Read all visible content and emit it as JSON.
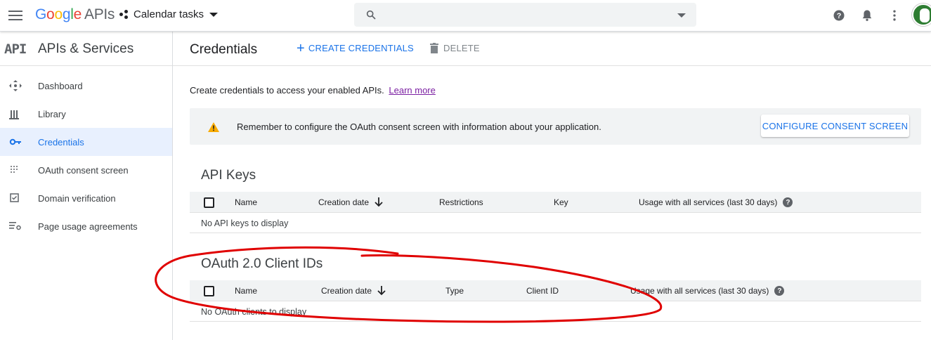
{
  "topbar": {
    "brand_google": [
      "G",
      "o",
      "o",
      "g",
      "l",
      "e"
    ],
    "brand_apis": "APIs",
    "project_name": "Calendar tasks",
    "search_placeholder": ""
  },
  "sidebar": {
    "logo": "API",
    "title": "APIs & Services",
    "items": [
      {
        "label": "Dashboard",
        "icon": "dashboard-icon",
        "active": false
      },
      {
        "label": "Library",
        "icon": "library-icon",
        "active": false
      },
      {
        "label": "Credentials",
        "icon": "key-icon",
        "active": true
      },
      {
        "label": "OAuth consent screen",
        "icon": "consent-icon",
        "active": false
      },
      {
        "label": "Domain verification",
        "icon": "checkbox-icon",
        "active": false
      },
      {
        "label": "Page usage agreements",
        "icon": "settings-list-icon",
        "active": false
      }
    ]
  },
  "main": {
    "title": "Credentials",
    "create_label": "CREATE CREDENTIALS",
    "delete_label": "DELETE",
    "intro_text": "Create credentials to access your enabled APIs.",
    "learn_more": "Learn more",
    "banner": {
      "message": "Remember to configure the OAuth consent screen with information about your application.",
      "button": "CONFIGURE CONSENT SCREEN"
    },
    "api_keys": {
      "title": "API Keys",
      "columns": [
        "Name",
        "Creation date",
        "Restrictions",
        "Key",
        "Usage with all services (last 30 days)"
      ],
      "empty": "No API keys to display"
    },
    "oauth": {
      "title": "OAuth 2.0 Client IDs",
      "columns": [
        "Name",
        "Creation date",
        "Type",
        "Client ID",
        "Usage with all services (last 30 days)"
      ],
      "empty": "No OAuth clients to display"
    }
  },
  "colors": {
    "accent": "#1a73e8",
    "warning": "#f9ab00",
    "annotation": "#e00000"
  }
}
